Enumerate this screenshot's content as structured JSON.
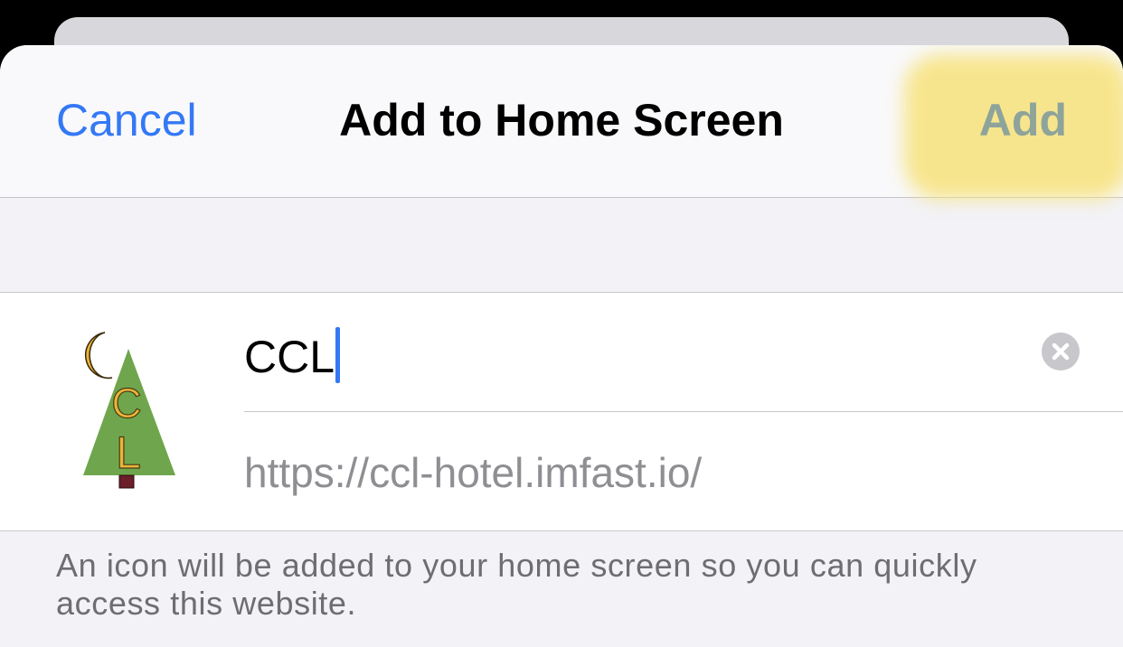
{
  "nav": {
    "cancel_label": "Cancel",
    "title": "Add to Home Screen",
    "add_label": "Add"
  },
  "form": {
    "name_value": "CCL",
    "url": "https://ccl-hotel.imfast.io/",
    "icon": {
      "name": "ccl-tree-moon-icon",
      "letters": [
        "C",
        "L"
      ]
    },
    "clear_icon": "clear-circle-icon"
  },
  "footer": {
    "text": "An icon will be added to your home screen so you can quickly access this website."
  },
  "colors": {
    "accent": "#3478f6",
    "highlight": "#f7e27a",
    "tree": "#6fa64d",
    "moon": "#eab53c",
    "trunk": "#6b1f2a"
  }
}
